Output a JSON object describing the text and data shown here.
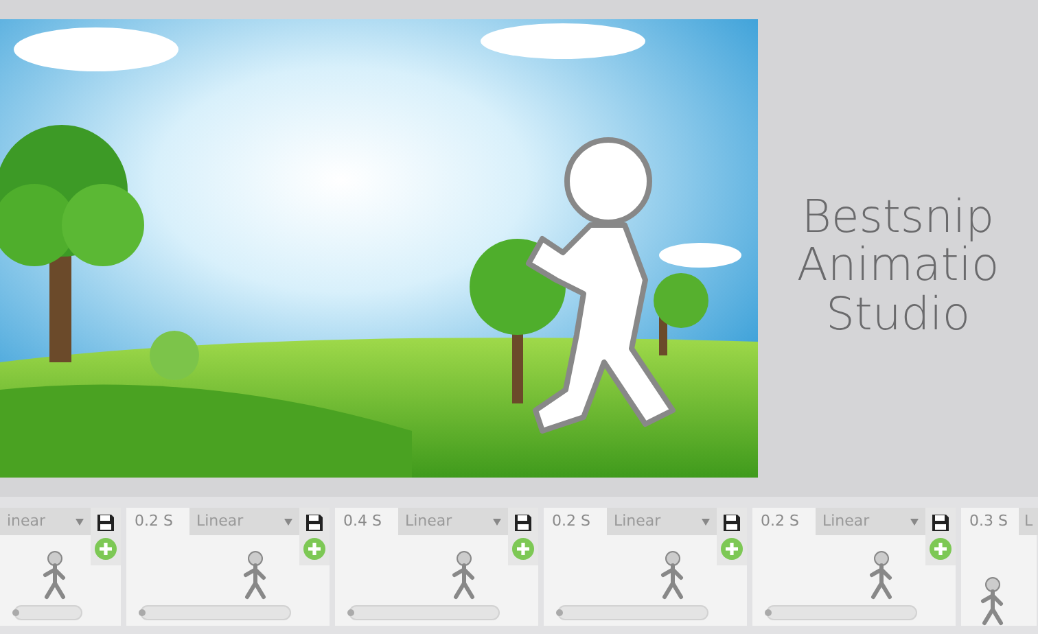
{
  "title_lines": [
    "Bestsnip",
    "Animatio",
    "Studio"
  ],
  "frames": [
    {
      "kind": "cut_left",
      "easing": "inear",
      "level": 0
    },
    {
      "kind": "full",
      "time": "0.2 S",
      "easing": "Linear",
      "level": 0
    },
    {
      "kind": "full",
      "time": "0.4 S",
      "easing": "Linear",
      "level": 0
    },
    {
      "kind": "full",
      "time": "0.2 S",
      "easing": "Linear",
      "level": 0
    },
    {
      "kind": "full",
      "time": "0.2 S",
      "easing": "Linear",
      "level": 0
    },
    {
      "kind": "cut_right",
      "time": "0.3 S",
      "easing": "L"
    }
  ]
}
